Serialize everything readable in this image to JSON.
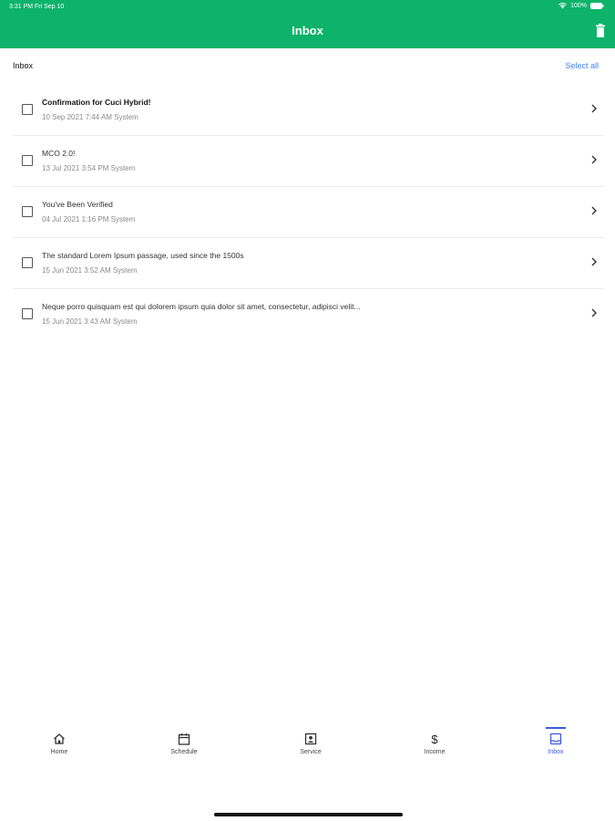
{
  "status_bar": {
    "time": "3:31 PM   Fri Sep 10",
    "battery": "100%"
  },
  "header": {
    "title": "Inbox",
    "color": "#0db36a",
    "trash_icon": "trash-icon"
  },
  "section": {
    "title": "Inbox",
    "select_all": "Select all"
  },
  "messages": [
    {
      "subject": "Confirmation for Cuci Hybrid!",
      "meta": "10 Sep 2021 7:44 AM System",
      "unread": true
    },
    {
      "subject": "MCO 2.0!",
      "meta": "13 Jul 2021 3:54 PM System",
      "unread": false
    },
    {
      "subject": "You've Been Verified",
      "meta": "04 Jul 2021 1:16 PM System",
      "unread": false
    },
    {
      "subject": "The standard Lorem Ipsum passage, used since the 1500s",
      "meta": "15 Jun 2021 3:52 AM System",
      "unread": false
    },
    {
      "subject": "Neque porro quisquam est qui dolorem ipsum quia dolor sit amet, consectetur, adipisci velit...",
      "meta": "15 Jun 2021 3:43 AM System",
      "unread": false
    }
  ],
  "tabs": [
    {
      "label": "Home",
      "icon": "home-icon",
      "active": false
    },
    {
      "label": "Schedule",
      "icon": "calendar-icon",
      "active": false
    },
    {
      "label": "Service",
      "icon": "service-icon",
      "active": false
    },
    {
      "label": "Income",
      "icon": "dollar-icon",
      "active": false
    },
    {
      "label": "Inbox",
      "icon": "inbox-icon",
      "active": true
    }
  ],
  "accent_color": "#3b5bdb"
}
